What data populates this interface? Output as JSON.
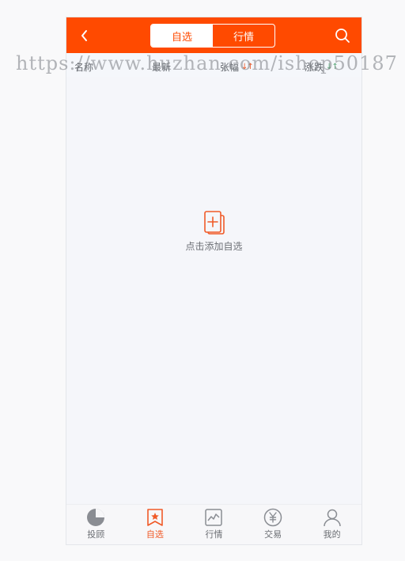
{
  "topbar": {
    "tabs": [
      {
        "label": "自选",
        "active": true
      },
      {
        "label": "行情",
        "active": false
      }
    ],
    "back_icon": "chevron-left-icon",
    "search_icon": "search-icon"
  },
  "columns": [
    {
      "label": "名称"
    },
    {
      "label": "最新"
    },
    {
      "label": "张幅"
    },
    {
      "label": "涨跌"
    }
  ],
  "watermark": "https://www.huzhan.com/ishop50187",
  "empty_state": {
    "label": "点击添加自选",
    "icon": "add-favorite-icon"
  },
  "bottom_nav": [
    {
      "label": "投顾",
      "icon": "pie-chart-icon",
      "active": false
    },
    {
      "label": "自选",
      "icon": "bookmark-star-icon",
      "active": true
    },
    {
      "label": "行情",
      "icon": "trend-chart-icon",
      "active": false
    },
    {
      "label": "交易",
      "icon": "yen-coin-icon",
      "active": false
    },
    {
      "label": "我的",
      "icon": "user-icon",
      "active": false
    }
  ],
  "colors": {
    "brand": "#ff4a00",
    "active_nav": "#f05a28",
    "sort_up_green": "#5aa878"
  }
}
